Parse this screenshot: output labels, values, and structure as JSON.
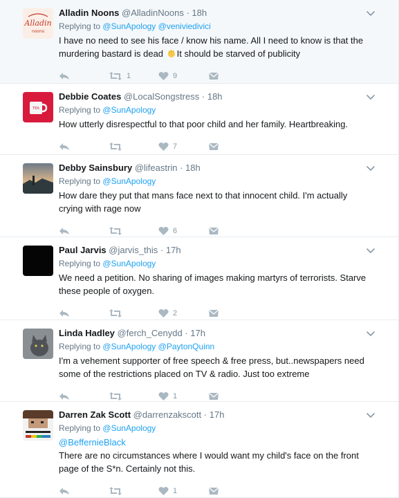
{
  "colors": {
    "accent": "#1da1f2",
    "muted": "#657786",
    "icon": "#aab8c2"
  },
  "tweets": [
    {
      "avatar": "alladin-logo",
      "name": "Alladin Noons",
      "handle": "@AlladinNoons",
      "sep": "·",
      "time": "18h",
      "replying_prefix": "Replying to",
      "replying_to": [
        "@SunApology",
        "@veniviedivici"
      ],
      "text_before_emoji": "I have no need to see his face / know his name. All I need to know is that the murdering bastard is dead ",
      "emoji": "clapping-hands-icon",
      "text_after_emoji": "It should be starved of publicity",
      "retweets": "1",
      "likes": "9"
    },
    {
      "avatar": "red-mug",
      "name": "Debbie Coates",
      "handle": "@LocalSongstress",
      "sep": "·",
      "time": "18h",
      "replying_prefix": "Replying to",
      "replying_to": [
        "@SunApology"
      ],
      "text": "How utterly disrespectful to that poor child and her family. Heartbreaking.",
      "retweets": "",
      "likes": "7"
    },
    {
      "avatar": "sunset-landscape",
      "name": "Debby Sainsbury",
      "handle": "@lifeastrin",
      "sep": "·",
      "time": "18h",
      "replying_prefix": "Replying to",
      "replying_to": [
        "@SunApology"
      ],
      "text": "How dare they put that mans face next to that innocent child. I'm actually crying with rage now",
      "retweets": "",
      "likes": "6"
    },
    {
      "avatar": "black-square",
      "name": "Paul Jarvis",
      "handle": "@jarvis_this",
      "sep": "·",
      "time": "17h",
      "replying_prefix": "Replying to",
      "replying_to": [
        "@SunApology"
      ],
      "text": "We need a petition. No sharing of images making martyrs of terrorists. Starve these people of oxygen.",
      "retweets": "",
      "likes": "2"
    },
    {
      "avatar": "cat-photo",
      "name": "Linda Hadley",
      "handle": "@ferch_Cenydd",
      "sep": "·",
      "time": "17h",
      "replying_prefix": "Replying to",
      "replying_to": [
        "@SunApology",
        "@PaytonQuinn"
      ],
      "text": "I'm a vehement supporter of free speech & free press, but..newspapers need some of the restrictions placed on TV & radio. Just too extreme",
      "retweets": "",
      "likes": "1"
    },
    {
      "avatar": "pixel-art",
      "name": "Darren Zak Scott",
      "handle": "@darrenzakscott",
      "sep": "·",
      "time": "17h",
      "replying_prefix": "Replying to",
      "replying_to": [
        "@SunApology"
      ],
      "mention_line": "@BeffernieBlack",
      "text": "There are no circumstances where I would want my child's face on the front page of the S*n. Certainly not this.",
      "retweets": "",
      "likes": "1"
    }
  ]
}
